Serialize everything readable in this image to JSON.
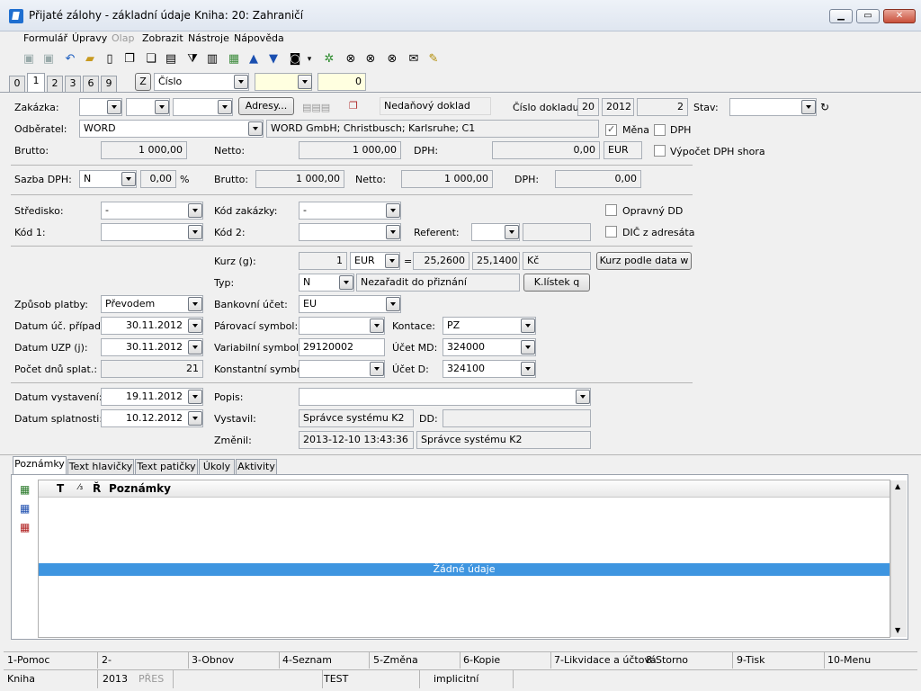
{
  "window": {
    "title": "Přijaté zálohy - základní údaje",
    "book": "Kniha: 20: Zahraničí"
  },
  "menu": [
    "Formulář",
    "Úpravy",
    "Olap",
    "Zobrazit",
    "Nástroje",
    "Nápověda"
  ],
  "tabs": [
    "0",
    "1",
    "2",
    "3",
    "6",
    "9"
  ],
  "sort": {
    "key_label": "Z",
    "field": "Číslo",
    "value": "0"
  },
  "form": {
    "zakazka_label": "Zakázka:",
    "adresy_button": "Adresy...",
    "nedanovy": "Nedaňový doklad",
    "cislo_label": "Číslo dokladu:",
    "cislo_prefix": "20",
    "cislo_year": "2012",
    "cislo_num": "2",
    "stav_label": "Stav:",
    "odberatel_label": "Odběratel:",
    "odberatel": "WORD",
    "odberatel_addr": "WORD GmbH; Christbusch; Karlsruhe; C1",
    "mena_label": "Měna",
    "dph_label": "DPH",
    "brutto_label": "Brutto:",
    "brutto": "1 000,00",
    "netto_label": "Netto:",
    "netto": "1 000,00",
    "dph_amount_label": "DPH:",
    "dph_amount": "0,00",
    "currency": "EUR",
    "dph_eur": "0,00",
    "vypocet_label": "Výpočet DPH shora",
    "sazba_label": "Sazba DPH:",
    "sazba": "N",
    "sazba_pct": "0,00",
    "pct": "%",
    "brutto2": "1 000,00",
    "netto2": "1 000,00",
    "dph2": "0,00",
    "stredisko_label": "Středisko:",
    "stredisko": "-",
    "kod_zakazky_label": "Kód zakázky:",
    "kod_zakazky": "-",
    "opravny_label": "Opravný DD",
    "kod1_label": "Kód 1:",
    "kod2_label": "Kód 2:",
    "referent_label": "Referent:",
    "dic_label": "DIČ z adresáta",
    "kurz_label": "Kurz (g):",
    "kurz_qty": "1",
    "kurz_cur": "EUR",
    "eq": "=",
    "kurz_rate": "25,2600",
    "kurz_rate2": "25,1400",
    "kurz_kc": "Kč",
    "kurz_btn": "Kurz podle data w",
    "typ_label": "Typ:",
    "typ": "N",
    "typ_desc": "Nezařadit do přiznání",
    "klistek_btn": "K.lístek q",
    "zpusob_label": "Způsob platby:",
    "zpusob": "Převodem",
    "bank_label": "Bankovní účet:",
    "bank": "EU",
    "datum_uc_label": "Datum úč. případu:",
    "datum_uc": "30.11.2012",
    "parovaci_label": "Párovací symbol:",
    "kontace_label": "Kontace:",
    "kontace": "PZ",
    "datum_uzp_label": "Datum UZP (j):",
    "datum_uzp": "30.11.2012",
    "vs_label": "Variabilní symbol:",
    "vs": "29120002",
    "ucet_md_label": "Účet MD:",
    "ucet_md": "324000",
    "pocet_label": "Počet dnů splat.:",
    "pocet": "21",
    "ks_label": "Konstantní symbol:",
    "ucet_d_label": "Účet D:",
    "ucet_d": "324100",
    "vystaveni_label": "Datum vystavení:",
    "vystaveni": "19.11.2012",
    "popis_label": "Popis:",
    "splatnost_label": "Datum splatnosti:",
    "splatnost": "10.12.2012",
    "vystavil_label": "Vystavil:",
    "vystavil": "Správce systému K2",
    "dd_label": "DD:",
    "zmenil_label": "Změnil:",
    "zmenil_date": "2013-12-10 13:43:36",
    "zmenil": "Správce systému K2"
  },
  "bottom_tabs": [
    "Poznámky",
    "Text hlavičky",
    "Text patičky",
    "Úkoly",
    "Aktivity"
  ],
  "grid": {
    "col_t": "T",
    "col_sort": "⁄₃",
    "col_r": "Ř",
    "col_notes": "Poznámky",
    "empty": "Žádné údaje"
  },
  "fkeys": [
    "1-Pomoc",
    "2-",
    "3-Obnov",
    "4-Seznam",
    "5-Změna",
    "6-Kopie",
    "7-Likvidace a účtová",
    "8-Storno",
    "9-Tisk",
    "10-Menu"
  ],
  "status": [
    "Kniha",
    "2013",
    "PŘES",
    "TEST",
    "implicitní"
  ]
}
